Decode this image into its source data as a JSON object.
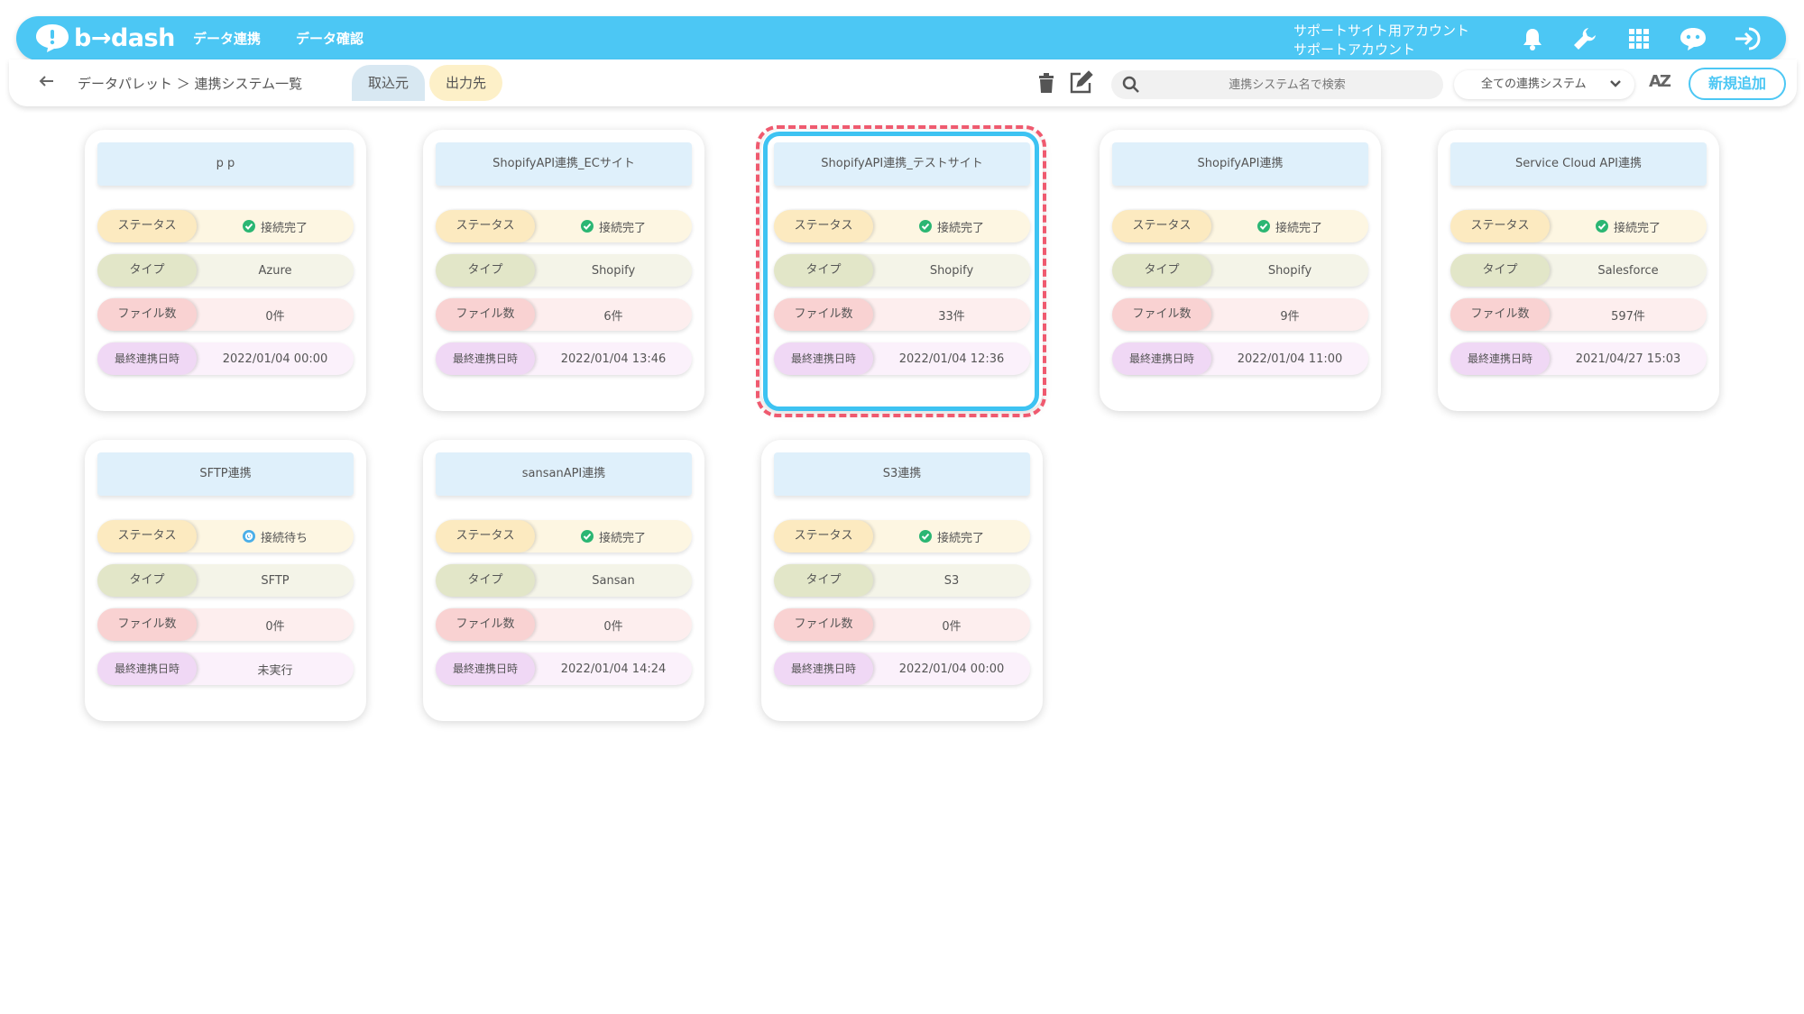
{
  "header": {
    "logo_text": "b→dash",
    "nav": [
      "データ連携",
      "データ確認"
    ],
    "account_line1": "サポートサイト用アカウント",
    "account_line2": "サポートアカウント",
    "icons": [
      "bell-icon",
      "wrench-icon",
      "apps-grid-icon",
      "chat-bot-icon",
      "logout-icon"
    ]
  },
  "toolbar": {
    "breadcrumb": "データパレット ＞ 連携システム一覧",
    "tab_import": "取込元",
    "tab_export": "出力先",
    "search_placeholder": "連携システム名で検索",
    "filter_value": "全ての連携システム",
    "sort_label": "AZ",
    "new_button": "新規追加"
  },
  "labels": {
    "status": "ステータス",
    "type": "タイプ",
    "files": "ファイル数",
    "last_run": "最終連携日時"
  },
  "cards": [
    {
      "title": "p p",
      "status": "接続完了",
      "status_kind": "ok",
      "type": "Azure",
      "files": "0件",
      "last_run": "2022/01/04 00:00"
    },
    {
      "title": "ShopifyAPI連携_ECサイト",
      "status": "接続完了",
      "status_kind": "ok",
      "type": "Shopify",
      "files": "6件",
      "last_run": "2022/01/04 13:46"
    },
    {
      "title": "ShopifyAPI連携_テストサイト",
      "status": "接続完了",
      "status_kind": "ok",
      "type": "Shopify",
      "files": "33件",
      "last_run": "2022/01/04 12:36",
      "highlighted": true
    },
    {
      "title": "ShopifyAPI連携",
      "status": "接続完了",
      "status_kind": "ok",
      "type": "Shopify",
      "files": "9件",
      "last_run": "2022/01/04 11:00"
    },
    {
      "title": "Service Cloud API連携",
      "status": "接続完了",
      "status_kind": "ok",
      "type": "Salesforce",
      "files": "597件",
      "last_run": "2021/04/27 15:03"
    },
    {
      "title": "SFTP連携",
      "status": "接続待ち",
      "status_kind": "waiting",
      "type": "SFTP",
      "files": "0件",
      "last_run": "未実行"
    },
    {
      "title": "sansanAPI連携",
      "status": "接続完了",
      "status_kind": "ok",
      "type": "Sansan",
      "files": "0件",
      "last_run": "2022/01/04 14:24"
    },
    {
      "title": "S3連携",
      "status": "接続完了",
      "status_kind": "ok",
      "type": "S3",
      "files": "0件",
      "last_run": "2022/01/04 00:00"
    }
  ],
  "colors": {
    "brand": "#4cc7f4",
    "status_ok": "#2bb673",
    "status_waiting": "#4aaee8",
    "highlight_dash": "#ef5a6f"
  }
}
